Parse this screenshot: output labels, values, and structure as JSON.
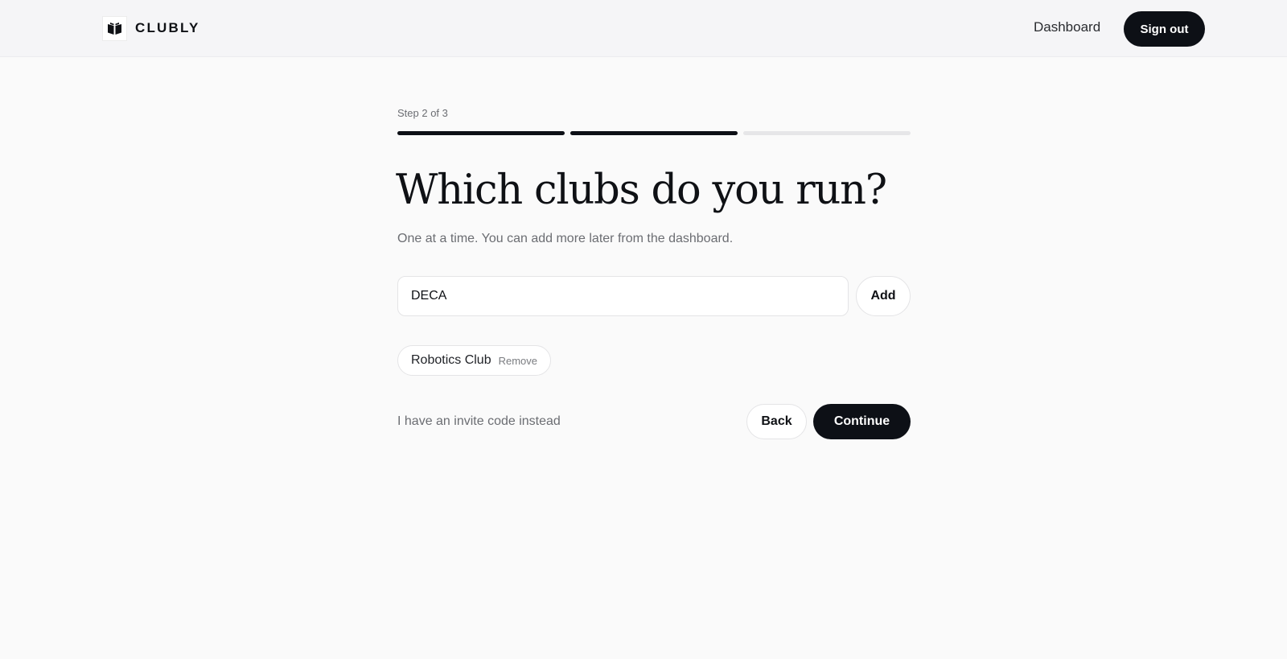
{
  "header": {
    "brand": "CLUBLY",
    "logo_icon": "open-book-icon",
    "nav_dashboard": "Dashboard",
    "sign_out": "Sign out"
  },
  "progress": {
    "label": "Step 2 of 3",
    "current_step": 2,
    "total_steps": 3
  },
  "main": {
    "title": "Which clubs do you run?",
    "subtitle": "One at a time. You can add more later from the dashboard.",
    "club_input_value": "DECA",
    "add_label": "Add",
    "clubs": [
      {
        "name": "Robotics Club",
        "remove_label": "Remove"
      }
    ],
    "invite_link": "I have an invite code instead",
    "back_label": "Back",
    "continue_label": "Continue"
  },
  "colors": {
    "accent_dark": "#0d1016",
    "page_bg": "#fafafa",
    "topbar_bg": "#f5f5f7",
    "track_inactive": "#e6e6e8",
    "muted_text": "#6b6d72"
  }
}
